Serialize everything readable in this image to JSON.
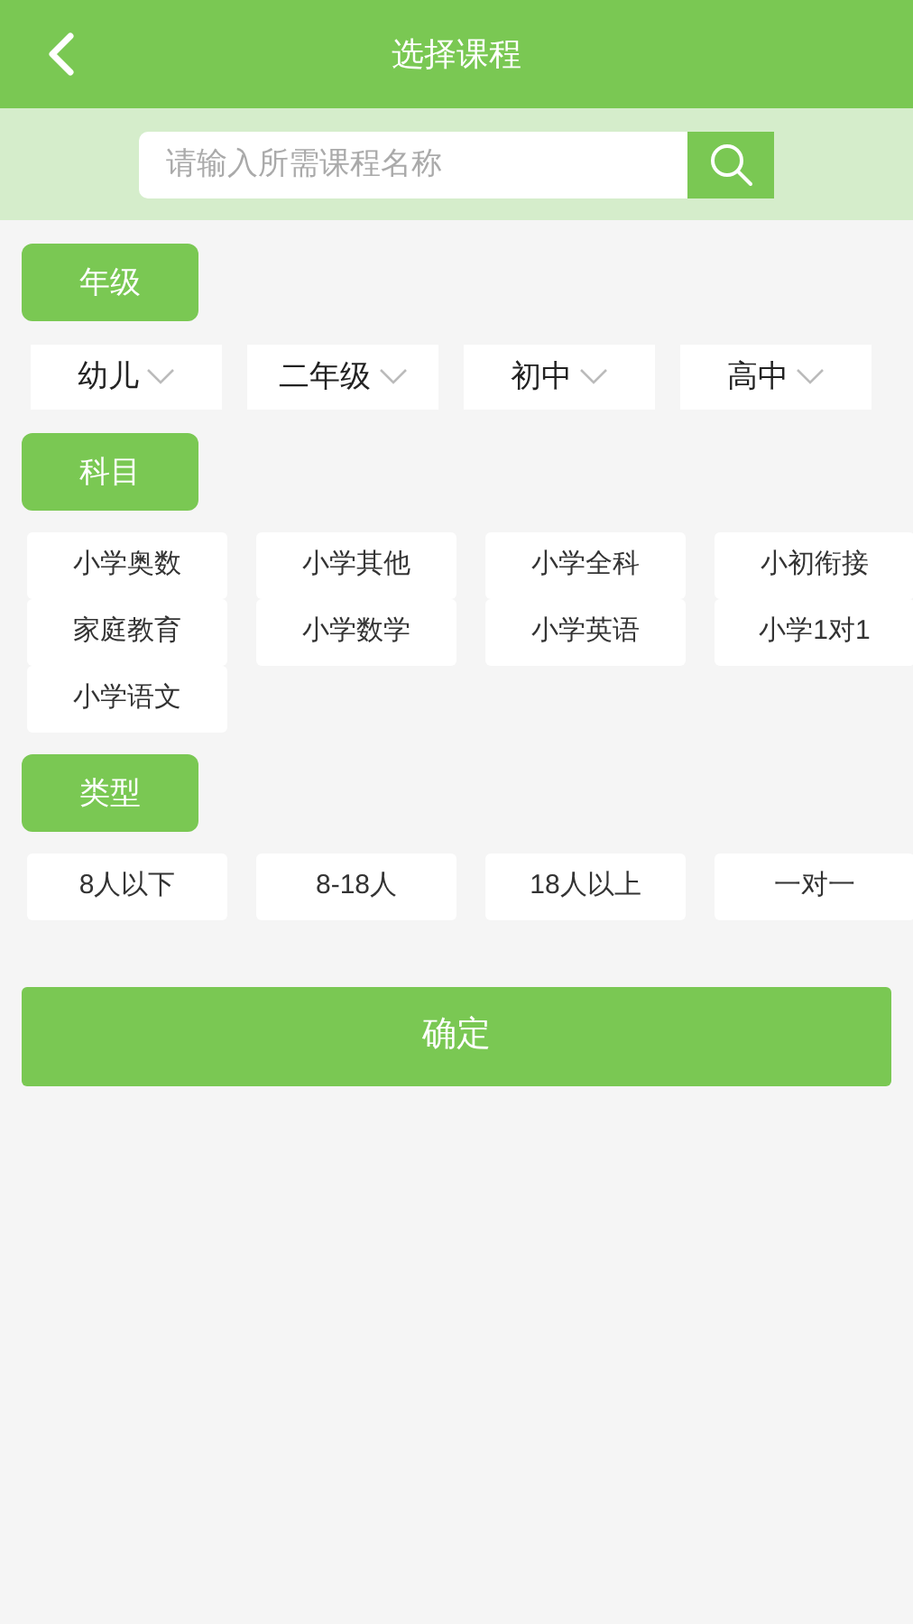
{
  "header": {
    "title": "选择课程"
  },
  "search": {
    "placeholder": "请输入所需课程名称"
  },
  "sections": [
    {
      "label": "年级",
      "kind": "dropdowns",
      "options": [
        "幼儿",
        "二年级",
        "初中",
        "高中"
      ]
    },
    {
      "label": "科目",
      "kind": "chips",
      "options": [
        "小学奥数",
        "小学其他",
        "小学全科",
        "小初衔接",
        "家庭教育",
        "小学数学",
        "小学英语",
        "小学1对1",
        "小学语文"
      ]
    },
    {
      "label": "类型",
      "kind": "chips",
      "options": [
        "8人以下",
        "8-18人",
        "18人以上",
        "一对一"
      ]
    }
  ],
  "confirm_button": "确定"
}
